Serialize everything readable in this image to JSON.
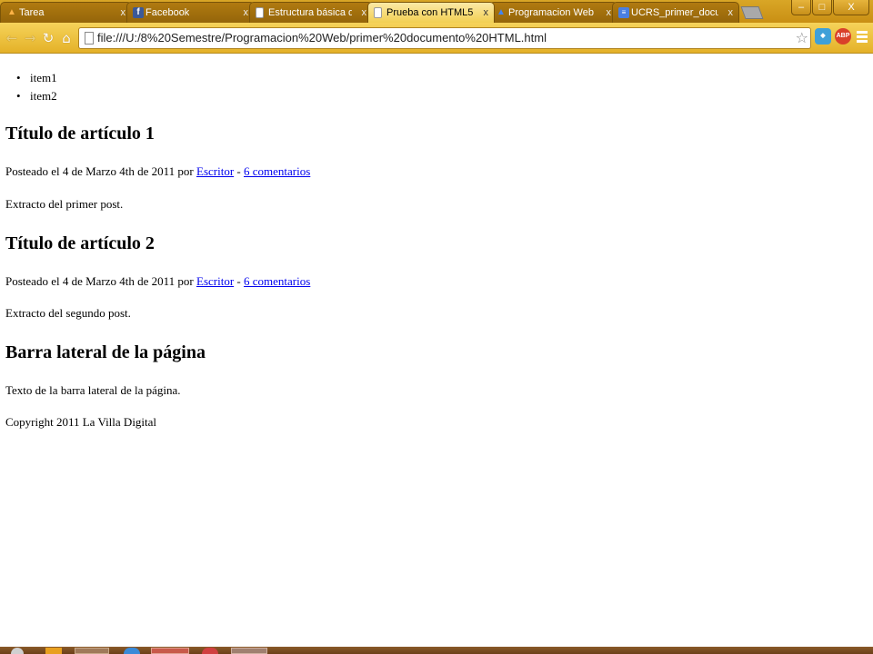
{
  "browser": {
    "tabs": [
      {
        "title": "Tarea",
        "active": false,
        "icon": "flame-icon",
        "color": "#d9922a"
      },
      {
        "title": "Facebook",
        "active": false,
        "icon": "facebook-icon",
        "color": "#3b5998"
      },
      {
        "title": "Estructura básica de una p",
        "active": false,
        "icon": "page-icon",
        "color": "#ffffff"
      },
      {
        "title": "Prueba con HTML5",
        "active": true,
        "icon": "page-icon",
        "color": "#ffffff"
      },
      {
        "title": "Programacion Web - Goo",
        "active": false,
        "icon": "drive-icon",
        "color": "#4285f4"
      },
      {
        "title": "UCRS_primer_documento",
        "active": false,
        "icon": "docs-icon",
        "color": "#4a7fe0"
      }
    ],
    "tab_close_glyph": "x",
    "window_controls": {
      "minimize": "–",
      "maximize": "□",
      "close": "X"
    },
    "url": "file:///U:/8%20Semestre/Programacion%20Web/primer%20documento%20HTML.html",
    "extensions": [
      {
        "name": "shield-extension-icon",
        "label": "",
        "color": "#3fa0d8"
      },
      {
        "name": "adblock-plus-icon",
        "label": "ABP",
        "color": "#d9412a"
      }
    ]
  },
  "document": {
    "list_items": [
      "item1",
      "item2"
    ],
    "articles": [
      {
        "title": "Título de artículo 1",
        "meta_prefix": "Posteado el 4 de Marzo 4th de 2011 por ",
        "author": "Escritor",
        "separator": " - ",
        "comments": "6 comentarios",
        "excerpt": "Extracto del primer post."
      },
      {
        "title": "Título de artículo 2",
        "meta_prefix": "Posteado el 4 de Marzo 4th de 2011 por ",
        "author": "Escritor",
        "separator": " - ",
        "comments": "6 comentarios",
        "excerpt": "Extracto del segundo post."
      }
    ],
    "sidebar_title": "Barra lateral de la página",
    "sidebar_text": "Texto de la barra lateral de la página.",
    "footer": "Copyright 2011 La Villa Digital"
  },
  "colors": {
    "chrome_gold": "#e4b128",
    "link": "#0000ee",
    "taskbar": "#7a4a20"
  }
}
